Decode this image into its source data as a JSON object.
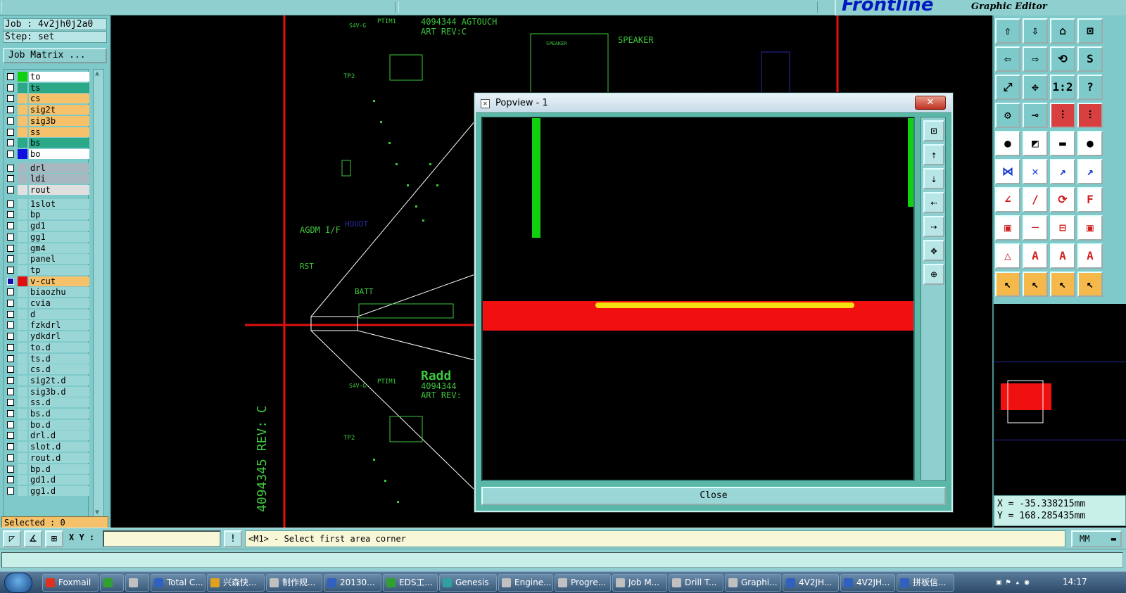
{
  "brand": {
    "logo": "Frontline",
    "subtitle": "Graphic Editor"
  },
  "job": {
    "job_line": "Job : 4v2jh0j2a0",
    "step_line": "Step: set",
    "matrix_button": "Job Matrix ..."
  },
  "layers": [
    {
      "name": "to",
      "color": "#ffffff",
      "swatch": "#10d010"
    },
    {
      "name": "ts",
      "color": "#2aa888",
      "swatch": "#2aa888"
    },
    {
      "name": "cs",
      "color": "#f5c16a",
      "swatch": "#f5c16a"
    },
    {
      "name": "sig2t",
      "color": "#f5c16a",
      "swatch": "#f5c16a"
    },
    {
      "name": "sig3b",
      "color": "#f5c16a",
      "swatch": "#f5c16a"
    },
    {
      "name": "ss",
      "color": "#f5c16a",
      "swatch": "#f5c16a"
    },
    {
      "name": "bs",
      "color": "#2aa888",
      "swatch": "#2aa888"
    },
    {
      "name": "bo",
      "color": "#ffffff",
      "swatch": "#1010e0"
    },
    {
      "name": "drl",
      "color": "#a8b8c0",
      "swatch": "#a8b8c0",
      "gap": true
    },
    {
      "name": "ldi",
      "color": "#a8b8c0",
      "swatch": "#a8b8c0"
    },
    {
      "name": "rout",
      "color": "#e0e0e0",
      "swatch": "#e0e0e0"
    },
    {
      "name": "1slot",
      "color": "#9bd6d6",
      "swatch": "#9bd6d6",
      "gap": true
    },
    {
      "name": "bp",
      "color": "#9bd6d6",
      "swatch": "#9bd6d6"
    },
    {
      "name": "gd1",
      "color": "#9bd6d6",
      "swatch": "#9bd6d6"
    },
    {
      "name": "gg1",
      "color": "#9bd6d6",
      "swatch": "#9bd6d6"
    },
    {
      "name": "gm4",
      "color": "#9bd6d6",
      "swatch": "#9bd6d6"
    },
    {
      "name": "panel",
      "color": "#9bd6d6",
      "swatch": "#9bd6d6"
    },
    {
      "name": "tp",
      "color": "#9bd6d6",
      "swatch": "#9bd6d6"
    },
    {
      "name": "v-cut",
      "color": "#f5c16a",
      "swatch": "#e01010",
      "active": true
    },
    {
      "name": "biaozhu",
      "color": "#9bd6d6",
      "swatch": "#9bd6d6"
    },
    {
      "name": "cvia",
      "color": "#9bd6d6",
      "swatch": "#9bd6d6"
    },
    {
      "name": "d",
      "color": "#9bd6d6",
      "swatch": "#9bd6d6"
    },
    {
      "name": "fzkdrl",
      "color": "#9bd6d6",
      "swatch": "#9bd6d6"
    },
    {
      "name": "ydkdrl",
      "color": "#9bd6d6",
      "swatch": "#9bd6d6"
    },
    {
      "name": "to.d",
      "color": "#9bd6d6",
      "swatch": "#9bd6d6"
    },
    {
      "name": "ts.d",
      "color": "#9bd6d6",
      "swatch": "#9bd6d6"
    },
    {
      "name": "cs.d",
      "color": "#9bd6d6",
      "swatch": "#9bd6d6"
    },
    {
      "name": "sig2t.d",
      "color": "#9bd6d6",
      "swatch": "#9bd6d6"
    },
    {
      "name": "sig3b.d",
      "color": "#9bd6d6",
      "swatch": "#9bd6d6"
    },
    {
      "name": "ss.d",
      "color": "#9bd6d6",
      "swatch": "#9bd6d6"
    },
    {
      "name": "bs.d",
      "color": "#9bd6d6",
      "swatch": "#9bd6d6"
    },
    {
      "name": "bo.d",
      "color": "#9bd6d6",
      "swatch": "#9bd6d6"
    },
    {
      "name": "drl.d",
      "color": "#9bd6d6",
      "swatch": "#9bd6d6"
    },
    {
      "name": "slot.d",
      "color": "#9bd6d6",
      "swatch": "#9bd6d6"
    },
    {
      "name": "rout.d",
      "color": "#9bd6d6",
      "swatch": "#9bd6d6"
    },
    {
      "name": "bp.d",
      "color": "#9bd6d6",
      "swatch": "#9bd6d6"
    },
    {
      "name": "gd1.d",
      "color": "#9bd6d6",
      "swatch": "#9bd6d6"
    },
    {
      "name": "gg1.d",
      "color": "#9bd6d6",
      "swatch": "#9bd6d6"
    }
  ],
  "selected": "Selected : 0",
  "canvas": {
    "silk": [
      "4094344 AGTOUCH",
      "ART REV:C",
      "SPEAKER",
      "SPEAKER",
      "AGDM I/F",
      "RST",
      "BATT",
      "PTIM1",
      "TP2",
      "4094345 REV: C",
      "4094344",
      "ART REV:",
      "PTIM1",
      "TP2",
      "S4V-G",
      "S4V-G",
      "HOUDT",
      "Radd"
    ]
  },
  "popup": {
    "title": "Popview - 1",
    "close_x": "✕",
    "close_label": "Close"
  },
  "coords": {
    "x": "X = -35.338215mm",
    "y": "Y = 168.285435mm"
  },
  "cmd": {
    "xy_label": "X Y :",
    "xy_value": "",
    "prompt": "<M1> - Select first area corner",
    "unit": "MM"
  },
  "taskbar": {
    "clock": "14:17",
    "items": [
      {
        "label": "Foxmail",
        "color": "#e03020"
      },
      {
        "label": "",
        "color": "#30a030"
      },
      {
        "label": "",
        "color": "#c0c0c0"
      },
      {
        "label": "Total C...",
        "color": "#3060c0"
      },
      {
        "label": "兴森快...",
        "color": "#e0a020"
      },
      {
        "label": "制作规...",
        "color": "#c0c0c0"
      },
      {
        "label": "20130...",
        "color": "#3060c0"
      },
      {
        "label": "EDS工...",
        "color": "#30a030"
      },
      {
        "label": "Genesis",
        "color": "#30a0a0"
      },
      {
        "label": "Engine...",
        "color": "#c0c0c0"
      },
      {
        "label": "Progre...",
        "color": "#c0c0c0"
      },
      {
        "label": "Job M...",
        "color": "#c0c0c0"
      },
      {
        "label": "Drill T...",
        "color": "#c0c0c0"
      },
      {
        "label": "Graphi...",
        "color": "#c0c0c0"
      },
      {
        "label": "4V2JH...",
        "color": "#3060c0"
      },
      {
        "label": "4V2JH...",
        "color": "#3060c0"
      },
      {
        "label": "拼板信...",
        "color": "#3060c0"
      }
    ]
  }
}
